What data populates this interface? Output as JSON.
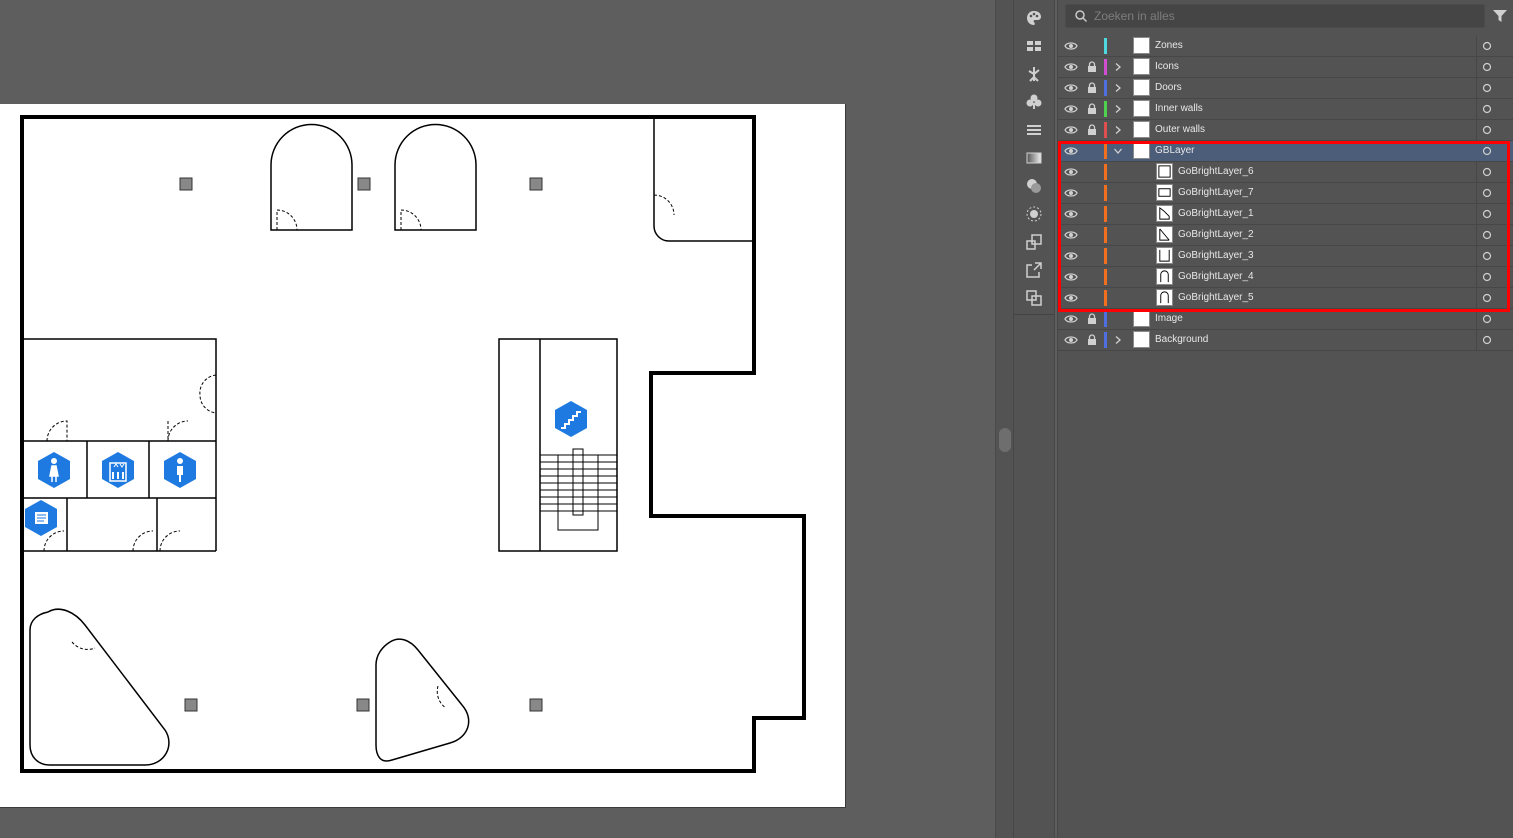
{
  "canvas": {
    "artboard_background": "#ffffff",
    "icons": [
      "women-restroom-icon",
      "elevator-icon",
      "men-restroom-icon",
      "printer-icon",
      "stairs-icon"
    ],
    "icon_color": "#1e7ae0"
  },
  "toolbar": {
    "tools": [
      "color-palette-icon",
      "libraries-icon",
      "puppet-warp-icon",
      "symbols-icon",
      "align-icon",
      "gradient-icon",
      "transparency-icon",
      "appearance-icon",
      "transform-icon",
      "export-icon",
      "pathfinder-icon"
    ]
  },
  "layers_panel": {
    "search": {
      "placeholder": "Zoeken in alles",
      "value": ""
    },
    "filter_icon": "filter-icon",
    "layers": [
      {
        "name": "Zones",
        "color": "#4fd8e0",
        "locked": false,
        "expandable": false,
        "expanded": false,
        "indent": 0,
        "selected": false
      },
      {
        "name": "Icons",
        "color": "#d04fd0",
        "locked": true,
        "expandable": true,
        "expanded": false,
        "indent": 0,
        "selected": false
      },
      {
        "name": "Doors",
        "color": "#4f6fe0",
        "locked": true,
        "expandable": true,
        "expanded": false,
        "indent": 0,
        "selected": false
      },
      {
        "name": "Inner walls",
        "color": "#4fd04f",
        "locked": true,
        "expandable": true,
        "expanded": false,
        "indent": 0,
        "selected": false
      },
      {
        "name": "Outer walls",
        "color": "#e04f4f",
        "locked": true,
        "expandable": true,
        "expanded": false,
        "indent": 0,
        "selected": false
      },
      {
        "name": "GBLayer",
        "color": "#f07020",
        "locked": false,
        "expandable": true,
        "expanded": true,
        "indent": 0,
        "selected": true
      },
      {
        "name": "GoBrightLayer_6",
        "color": "#f07020",
        "locked": false,
        "expandable": false,
        "expanded": false,
        "indent": 1,
        "selected": false
      },
      {
        "name": "GoBrightLayer_7",
        "color": "#f07020",
        "locked": false,
        "expandable": false,
        "expanded": false,
        "indent": 1,
        "selected": false
      },
      {
        "name": "GoBrightLayer_1",
        "color": "#f07020",
        "locked": false,
        "expandable": false,
        "expanded": false,
        "indent": 1,
        "selected": false
      },
      {
        "name": "GoBrightLayer_2",
        "color": "#f07020",
        "locked": false,
        "expandable": false,
        "expanded": false,
        "indent": 1,
        "selected": false
      },
      {
        "name": "GoBrightLayer_3",
        "color": "#f07020",
        "locked": false,
        "expandable": false,
        "expanded": false,
        "indent": 1,
        "selected": false
      },
      {
        "name": "GoBrightLayer_4",
        "color": "#f07020",
        "locked": false,
        "expandable": false,
        "expanded": false,
        "indent": 1,
        "selected": false
      },
      {
        "name": "GoBrightLayer_5",
        "color": "#f07020",
        "locked": false,
        "expandable": false,
        "expanded": false,
        "indent": 1,
        "selected": false
      },
      {
        "name": "Image",
        "color": "#4f6fe0",
        "locked": true,
        "expandable": false,
        "expanded": false,
        "indent": 0,
        "selected": false
      },
      {
        "name": "Background",
        "color": "#4f6fe0",
        "locked": true,
        "expandable": true,
        "expanded": false,
        "indent": 0,
        "selected": false
      }
    ],
    "highlight_color": "#ff0000"
  }
}
